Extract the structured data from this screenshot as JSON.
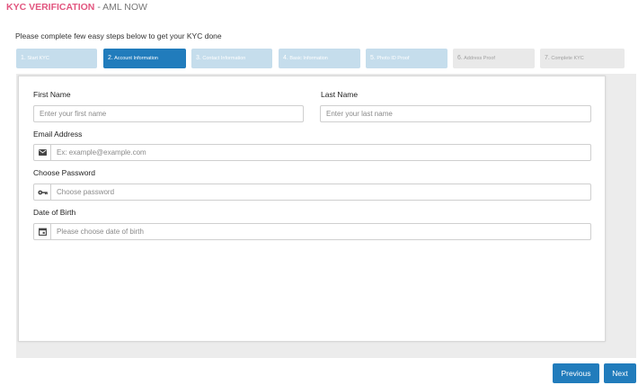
{
  "header": {
    "brand": "KYC VERIFICATION",
    "subtitle": "- AML NOW"
  },
  "intro": "Please complete few easy steps below to get your KYC done",
  "steps": [
    {
      "num": "1.",
      "label": "Start KYC",
      "state": "done"
    },
    {
      "num": "2.",
      "label": "Account Information",
      "state": "active"
    },
    {
      "num": "3.",
      "label": "Contact Information",
      "state": "done"
    },
    {
      "num": "4.",
      "label": "Basic Information",
      "state": "done"
    },
    {
      "num": "5.",
      "label": "Photo ID Proof",
      "state": "done"
    },
    {
      "num": "6.",
      "label": "Address Proof",
      "state": "todo"
    },
    {
      "num": "7.",
      "label": "Complete KYC",
      "state": "todo"
    }
  ],
  "form": {
    "first_name_label": "First Name",
    "first_name_placeholder": "Enter your first name",
    "last_name_label": "Last Name",
    "last_name_placeholder": "Enter your last name",
    "email_label": "Email Address",
    "email_placeholder": "Ex: example@example.com",
    "password_label": "Choose Password",
    "password_placeholder": "Choose password",
    "dob_label": "Date of Birth",
    "dob_placeholder": "Please choose date of birth"
  },
  "buttons": {
    "previous": "Previous",
    "next": "Next"
  },
  "colors": {
    "brand": "#e2557f",
    "accent": "#217cbc",
    "step_done": "#c5ddec",
    "step_todo": "#e9e9e9"
  },
  "icons": {
    "email": "envelope-icon",
    "password": "key-icon",
    "dob": "calendar-icon"
  }
}
